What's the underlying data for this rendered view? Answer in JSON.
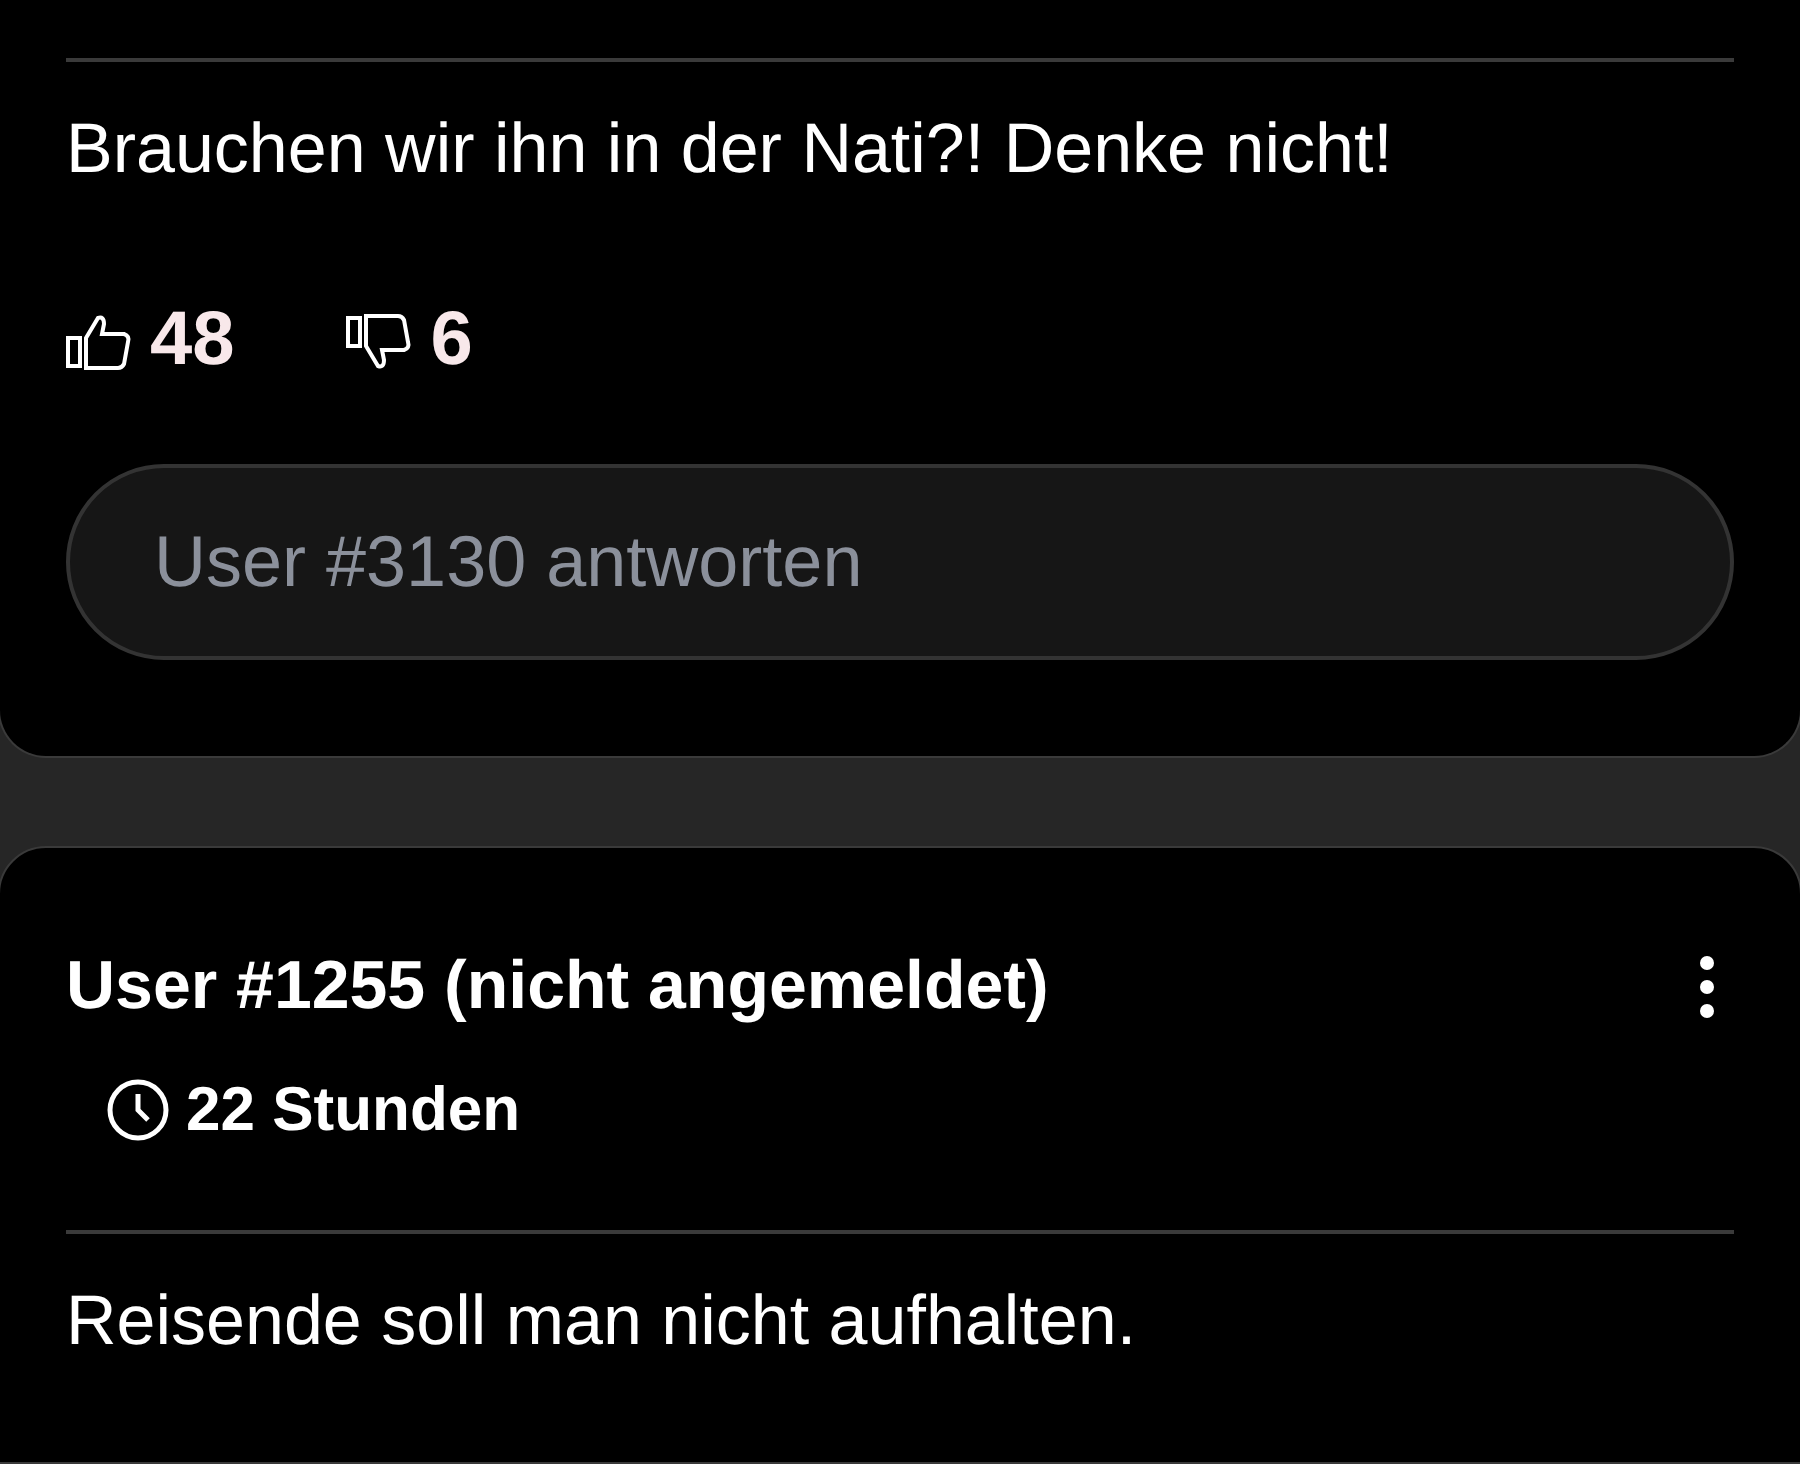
{
  "comments": [
    {
      "text": "Brauchen wir ihn in der Nati?! Denke nicht!",
      "likes": "48",
      "dislikes": "6",
      "reply_placeholder": "User #3130 antworten"
    },
    {
      "author": "User #1255 (nicht angemeldet)",
      "time": "22 Stunden",
      "text": "Reisende soll man nicht aufhalten."
    }
  ]
}
